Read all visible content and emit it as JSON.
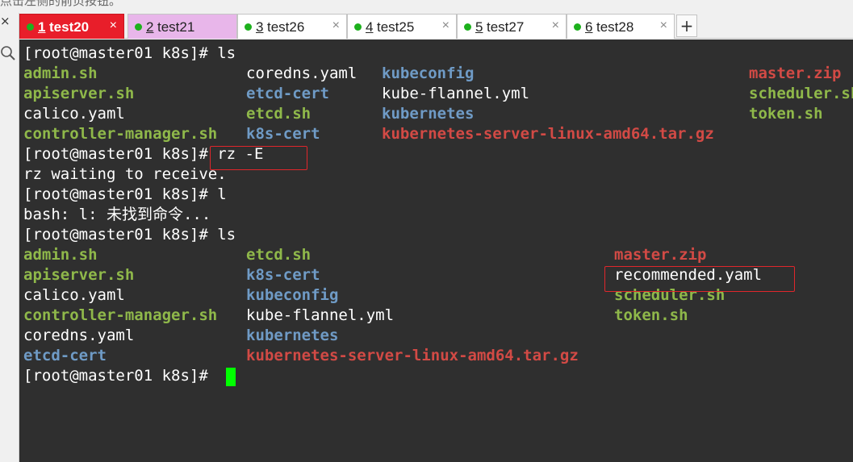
{
  "window": {
    "top_fragment": "点击左侧的前页按钮。",
    "left_close_glyph": "×"
  },
  "tabs": [
    {
      "num": "1",
      "name": "test20",
      "close": "×",
      "active": true,
      "dot_color": "#1db11d"
    },
    {
      "num": "2",
      "name": "test21",
      "close": "",
      "active": false,
      "dot_color": "#1db11d"
    },
    {
      "num": "3",
      "name": "test26",
      "close": "×",
      "active": false,
      "dot_color": "#1db11d"
    },
    {
      "num": "4",
      "name": "test25",
      "close": "×",
      "active": false,
      "dot_color": "#1db11d"
    },
    {
      "num": "5",
      "name": "test27",
      "close": "×",
      "active": false,
      "dot_color": "#1db11d"
    },
    {
      "num": "6",
      "name": "test28",
      "close": "×",
      "active": false,
      "dot_color": "#1db11d"
    }
  ],
  "add_tab_label": "+",
  "terminal": {
    "prompt": "[root@master01 k8s]# ",
    "cmd_ls_1": "ls",
    "ls1_rows": [
      [
        {
          "text": "admin.sh",
          "style": "green"
        },
        {
          "text": "coredns.yaml",
          "style": "plain"
        },
        {
          "text": "kubeconfig",
          "style": "blue"
        },
        {
          "text": "master.zip",
          "style": "red"
        }
      ],
      [
        {
          "text": "apiserver.sh",
          "style": "green"
        },
        {
          "text": "etcd-cert",
          "style": "blue"
        },
        {
          "text": "kube-flannel.yml",
          "style": "plain"
        },
        {
          "text": "scheduler.sh",
          "style": "green"
        }
      ],
      [
        {
          "text": "calico.yaml",
          "style": "plain"
        },
        {
          "text": "etcd.sh",
          "style": "green"
        },
        {
          "text": "kubernetes",
          "style": "blue"
        },
        {
          "text": "token.sh",
          "style": "green"
        }
      ],
      [
        {
          "text": "controller-manager.sh",
          "style": "green"
        },
        {
          "text": "k8s-cert",
          "style": "blue"
        },
        {
          "text": "kubernetes-server-linux-amd64.tar.gz",
          "style": "red"
        },
        {
          "text": "",
          "style": "plain"
        }
      ]
    ],
    "cmd_rz": "rz -E",
    "rz_output": "rz waiting to receive.",
    "cmd_l": "l",
    "bash_error": "bash: l: 未找到命令...",
    "cmd_ls_2": "ls",
    "ls2_rows": [
      [
        {
          "text": "admin.sh",
          "style": "green"
        },
        {
          "text": "etcd.sh",
          "style": "green"
        },
        {
          "text": "master.zip",
          "style": "red"
        }
      ],
      [
        {
          "text": "apiserver.sh",
          "style": "green"
        },
        {
          "text": "k8s-cert",
          "style": "blue"
        },
        {
          "text": "recommended.yaml",
          "style": "plain"
        }
      ],
      [
        {
          "text": "calico.yaml",
          "style": "plain"
        },
        {
          "text": "kubeconfig",
          "style": "blue"
        },
        {
          "text": "scheduler.sh",
          "style": "green"
        }
      ],
      [
        {
          "text": "controller-manager.sh",
          "style": "green"
        },
        {
          "text": "kube-flannel.yml",
          "style": "plain"
        },
        {
          "text": "token.sh",
          "style": "green"
        }
      ],
      [
        {
          "text": "coredns.yaml",
          "style": "plain"
        },
        {
          "text": "kubernetes",
          "style": "blue"
        },
        {
          "text": "",
          "style": "plain"
        }
      ],
      [
        {
          "text": "etcd-cert",
          "style": "blue"
        },
        {
          "text": "kubernetes-server-linux-amd64.tar.gz",
          "style": "red"
        },
        {
          "text": "",
          "style": "plain"
        }
      ]
    ],
    "cursor_color": "#00ff00",
    "highlight_color": "#e0262b"
  }
}
